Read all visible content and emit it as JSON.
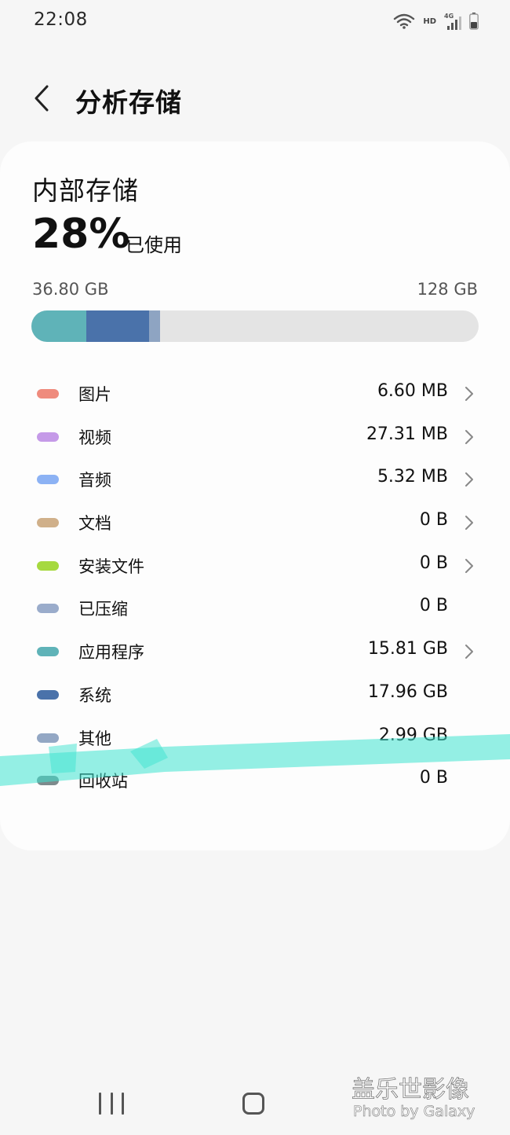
{
  "status_bar": {
    "time": "22:08",
    "hd_label": "HD",
    "network_label": "4G",
    "icons": [
      "wifi-icon",
      "hd-icon",
      "signal-4g-icon",
      "battery-icon"
    ]
  },
  "header": {
    "back_icon": "chevron-left-icon",
    "title": "分析存储"
  },
  "storage": {
    "title": "内部存储",
    "percent_used": "28%",
    "percent_label": "已使用",
    "used_amount": "36.80 GB",
    "total_amount": "128 GB",
    "bar_segments": [
      {
        "name": "应用程序",
        "fraction": 0.1235,
        "color": "#5fb3b8"
      },
      {
        "name": "系统",
        "fraction": 0.1403,
        "color": "#4a72aa"
      },
      {
        "name": "其他",
        "fraction": 0.0234,
        "color": "#8ea4c2"
      }
    ]
  },
  "categories": [
    {
      "label": "图片",
      "size": "6.60 MB",
      "color": "#ef8b7d",
      "has_chevron": true
    },
    {
      "label": "视频",
      "size": "27.31 MB",
      "color": "#c59ae8",
      "has_chevron": true
    },
    {
      "label": "音频",
      "size": "5.32 MB",
      "color": "#8cb2f4",
      "has_chevron": true
    },
    {
      "label": "文档",
      "size": "0 B",
      "color": "#d0b08a",
      "has_chevron": true
    },
    {
      "label": "安装文件",
      "size": "0 B",
      "color": "#a6d93f",
      "has_chevron": true
    },
    {
      "label": "已压缩",
      "size": "0 B",
      "color": "#9aaccb",
      "has_chevron": false
    },
    {
      "label": "应用程序",
      "size": "15.81 GB",
      "color": "#5fb3b8",
      "has_chevron": true
    },
    {
      "label": "系统",
      "size": "17.96 GB",
      "color": "#4a72aa",
      "has_chevron": false
    },
    {
      "label": "其他",
      "size": "2.99 GB",
      "color": "#93a7c4",
      "has_chevron": false
    },
    {
      "label": "回收站",
      "size": "0 B",
      "color": "#7d8a8c",
      "has_chevron": false
    }
  ],
  "annotation": {
    "color": "#3ee3cf",
    "description_icon": "highlighter-stroke"
  },
  "nav_bar": {
    "icons": [
      "recent-apps-icon",
      "home-icon"
    ]
  },
  "watermark": {
    "line1": "盖乐世影像",
    "line2": "Photo by Galaxy"
  }
}
